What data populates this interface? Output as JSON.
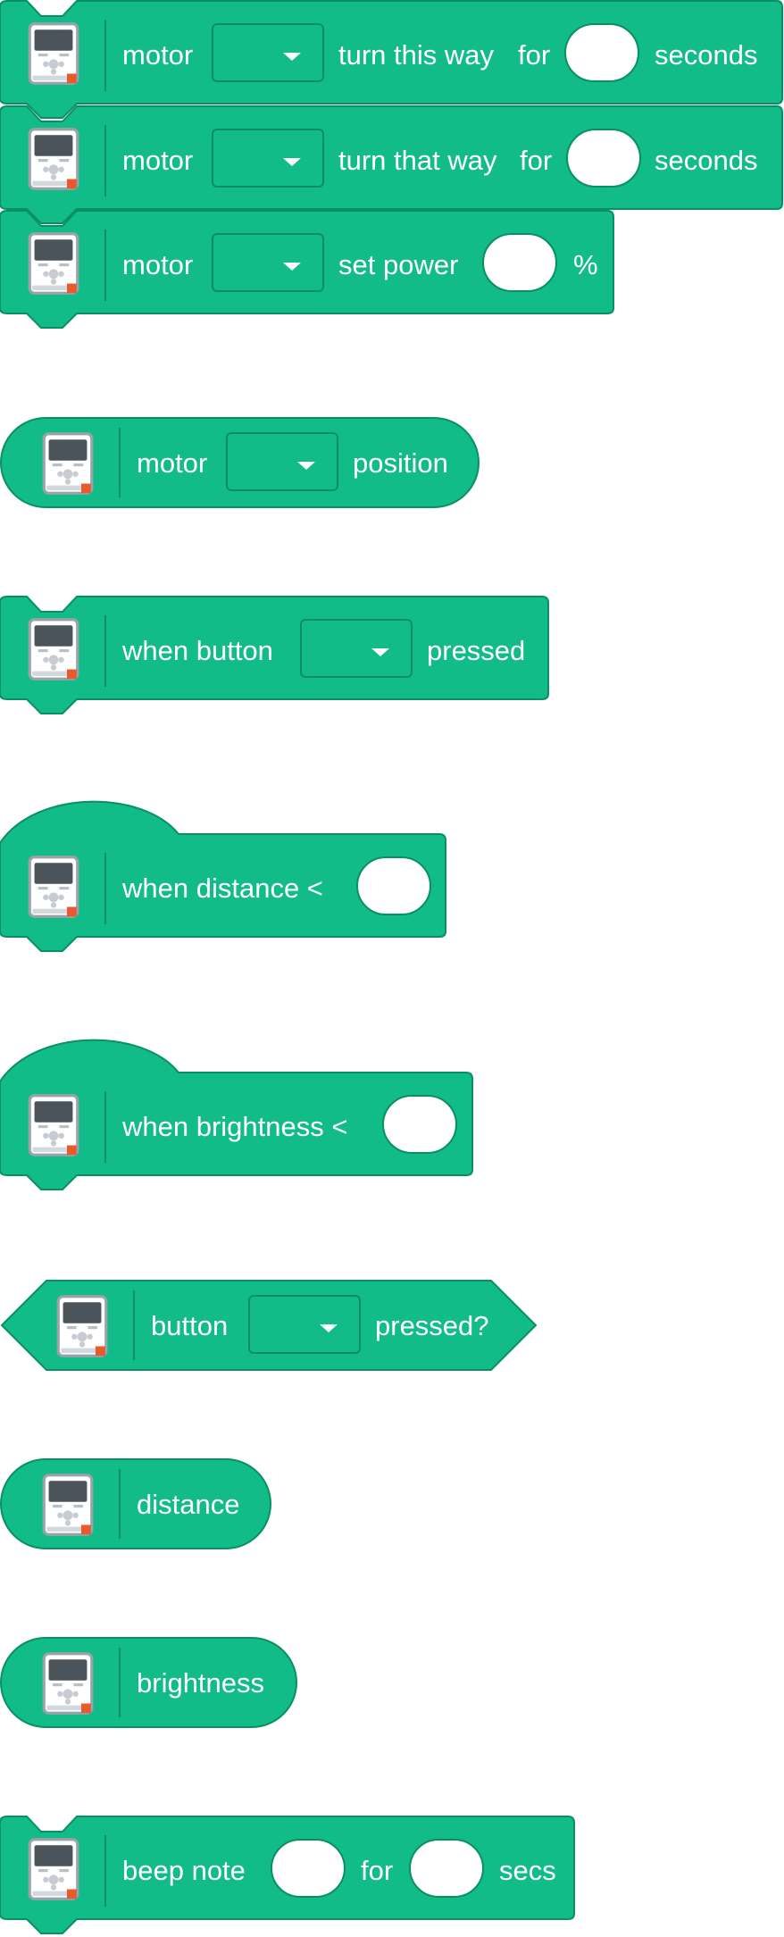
{
  "colors": {
    "block_fill": "#12bc89",
    "block_stroke": "#0a8f62",
    "text": "#ffffff",
    "input_fill": "#ffffff"
  },
  "icons": {
    "block_icon": "ev3-brick-icon",
    "dropdown_caret": "caret-down-icon"
  },
  "blocks": [
    {
      "id": "motor-turn-this-way",
      "motor_label": "motor",
      "action_label": "turn this way",
      "for_label": "for",
      "seconds_label": "seconds",
      "port_value": "",
      "seconds_value": ""
    },
    {
      "id": "motor-turn-that-way",
      "motor_label": "motor",
      "action_label": "turn that way",
      "for_label": "for",
      "seconds_label": "seconds",
      "port_value": "",
      "seconds_value": ""
    },
    {
      "id": "motor-set-power",
      "motor_label": "motor",
      "action_label": "set power",
      "unit_label": "%",
      "port_value": "",
      "power_value": ""
    },
    {
      "id": "motor-position",
      "motor_label": "motor",
      "suffix_label": "position",
      "port_value": ""
    },
    {
      "id": "when-button-pressed",
      "prefix_label": "when button",
      "suffix_label": "pressed",
      "button_value": ""
    },
    {
      "id": "when-distance",
      "label": "when distance <",
      "distance_value": ""
    },
    {
      "id": "when-brightness",
      "label": "when brightness <",
      "brightness_value": ""
    },
    {
      "id": "button-pressed",
      "prefix_label": "button",
      "suffix_label": "pressed?",
      "button_value": ""
    },
    {
      "id": "distance-reporter",
      "label": "distance"
    },
    {
      "id": "brightness-reporter",
      "label": "brightness"
    },
    {
      "id": "beep-note",
      "prefix_label": "beep note",
      "for_label": "for",
      "suffix_label": "secs",
      "note_value": "",
      "secs_value": ""
    }
  ]
}
